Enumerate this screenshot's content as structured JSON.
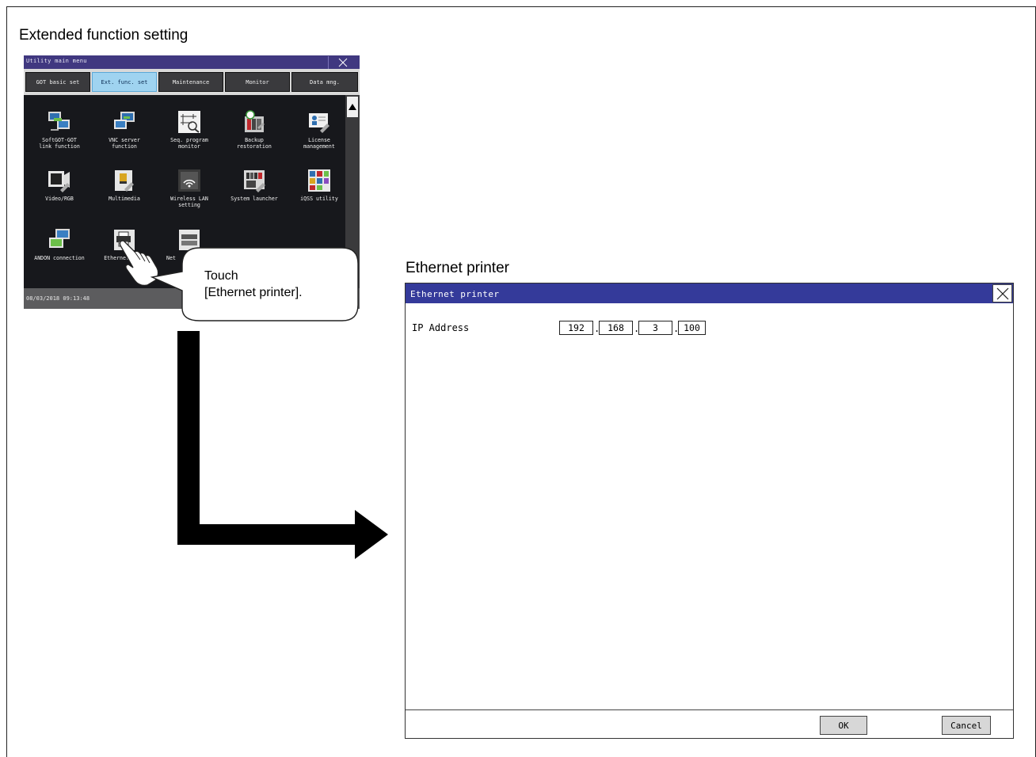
{
  "headings": {
    "left": "Extended function setting",
    "right": "Ethernet printer"
  },
  "got_menu": {
    "title": "Utility main menu",
    "close_icon": "close-icon",
    "tabs": [
      {
        "label": "GOT basic set",
        "active": false
      },
      {
        "label": "Ext. func. set",
        "active": true
      },
      {
        "label": "Maintenance",
        "active": false
      },
      {
        "label": "Monitor",
        "active": false
      },
      {
        "label": "Data mng.",
        "active": false
      }
    ],
    "items": [
      {
        "label": "SoftGOT-GOT\nlink function",
        "icon": "softgot-link-icon"
      },
      {
        "label": "VNC server\nfunction",
        "icon": "vnc-server-icon"
      },
      {
        "label": "Seq. program\nmonitor",
        "icon": "seq-program-monitor-icon"
      },
      {
        "label": "Backup\nrestoration",
        "icon": "backup-restoration-icon"
      },
      {
        "label": "License\nmanagement",
        "icon": "license-management-icon"
      },
      {
        "label": "Video/RGB",
        "icon": "video-rgb-icon"
      },
      {
        "label": "Multimedia",
        "icon": "multimedia-icon"
      },
      {
        "label": "Wireless LAN\nsetting",
        "icon": "wireless-lan-icon"
      },
      {
        "label": "System launcher",
        "icon": "system-launcher-icon"
      },
      {
        "label": "iQSS utility",
        "icon": "iqss-utility-icon"
      },
      {
        "label": "ANDON connection",
        "icon": "andon-connection-icon"
      },
      {
        "label": "Ethernet prin",
        "icon": "ethernet-printer-icon"
      },
      {
        "label": "Net",
        "icon": "network-icon"
      }
    ],
    "status_datetime": "08/03/2018 09:13:48",
    "scroll_up_icon": "scroll-up-icon"
  },
  "callout": {
    "text": "Touch\n[Ethernet printer]."
  },
  "dialog": {
    "title": "Ethernet printer",
    "ip_label": "IP Address",
    "ip_octets": [
      "192",
      "168",
      "3",
      "100"
    ],
    "ok_label": "OK",
    "cancel_label": "Cancel"
  },
  "colors": {
    "got_titlebar": "#403880",
    "got_active_tab": "#9fd3f0",
    "dialog_titlebar": "#343a9a"
  }
}
